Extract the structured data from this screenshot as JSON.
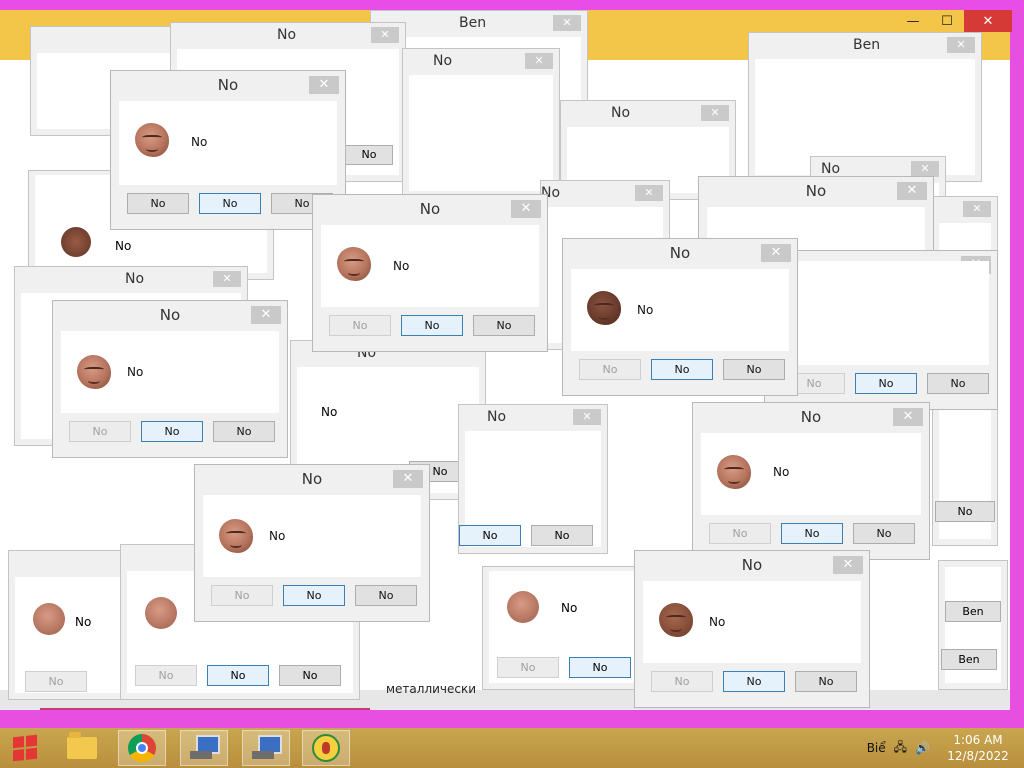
{
  "window": {
    "title_bg_labels": [
      "No",
      "Ben",
      "No",
      "Ben"
    ],
    "controls": {
      "minimize": "—",
      "maximize": "☐",
      "close": "✕"
    }
  },
  "dialogs": [
    {
      "title": "No",
      "message": "No",
      "buttons": [
        "No",
        "No",
        "No"
      ]
    }
  ],
  "fragment_titles": [
    "Ben",
    "No",
    "No",
    "No",
    "No",
    "No",
    "No",
    "No",
    "No",
    "No"
  ],
  "fragment_buttons": [
    "No",
    "No",
    "No",
    "No",
    "No",
    "No",
    "No",
    "Ben",
    "Ben"
  ],
  "fragment_text": [
    "No",
    "No",
    "No",
    "No",
    "No",
    "No",
    "металлически"
  ],
  "taskbar": {
    "tray_lang": "Biể",
    "time": "1:06 AM",
    "date": "12/8/2022",
    "ghost_date": "12/8/2022"
  },
  "icons": [
    "start-windows-icon",
    "file-explorer-icon",
    "chrome-icon",
    "computer-icon",
    "computer-icon",
    "game-icon",
    "network-icon",
    "volume-icon"
  ]
}
